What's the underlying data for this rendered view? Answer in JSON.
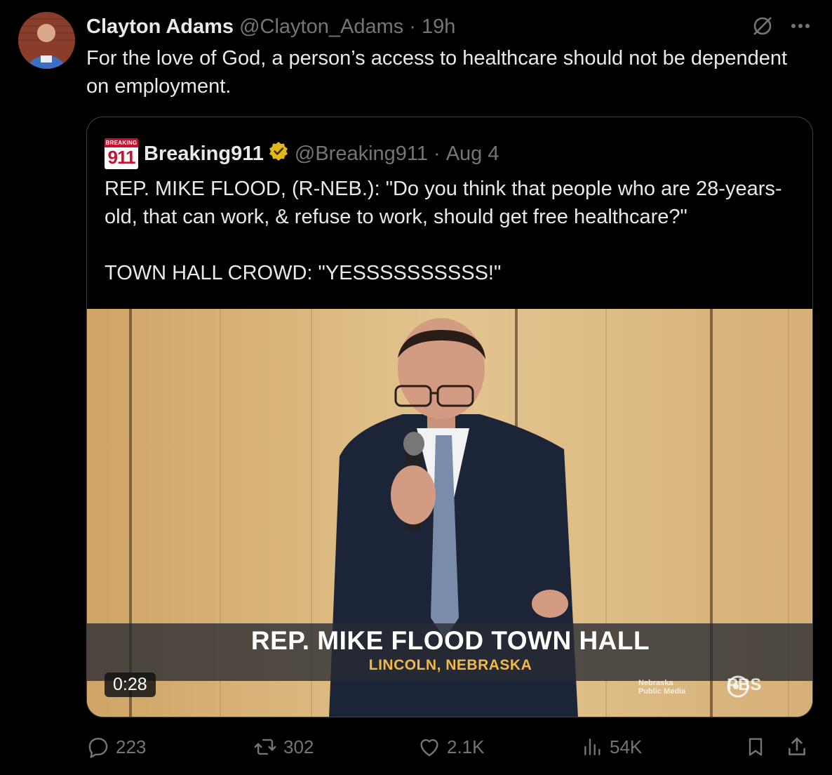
{
  "tweet": {
    "author_name": "Clayton Adams",
    "author_handle": "@Clayton_Adams",
    "separator": "·",
    "time": "19h",
    "text": "For the love of God, a person’s access to healthcare should not be dependent on employment."
  },
  "quote": {
    "logo_top": "BREAKING",
    "logo_number": "911",
    "author_name": "Breaking911",
    "author_handle": "@Breaking911",
    "separator": "·",
    "date": "Aug 4",
    "text": "REP. MIKE FLOOD, (R-NEB.): \"Do you think that people who are 28-years-old, that can work, & refuse to work, should get free healthcare?\"\n\nTOWN HALL CROWD: \"YESSSSSSSSSS!\"",
    "video": {
      "lower_third_title": "REP. MIKE FLOOD TOWN HALL",
      "lower_third_subtitle": "LINCOLN, NEBRASKA",
      "duration": "0:28",
      "watermark_line1": "Nebraska",
      "watermark_line2": "Public Media",
      "watermark_pbs": "PBS"
    }
  },
  "actions": {
    "replies": "223",
    "reposts": "302",
    "likes": "2.1K",
    "views": "54K"
  },
  "colors": {
    "background": "#000000",
    "text": "#e7e9ea",
    "muted": "#71767b",
    "verified_gold": "#e2b719"
  }
}
